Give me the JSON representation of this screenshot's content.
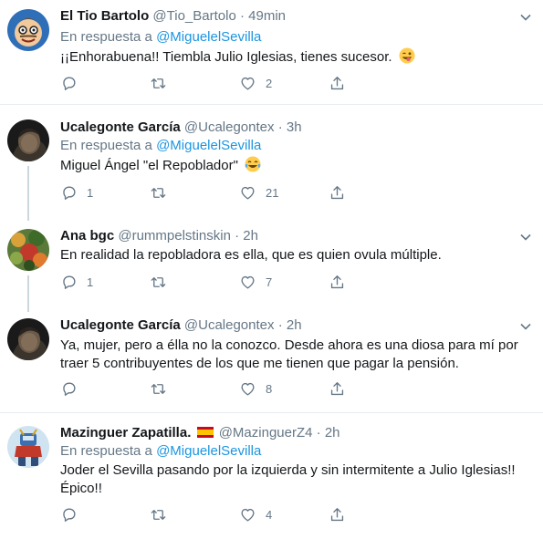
{
  "tweets": [
    {
      "name": "El Tio Bartolo",
      "handle": "@Tio_Bartolo",
      "dot": "·",
      "time": "49min",
      "reply_prefix": "En respuesta a",
      "reply_to": "@MiguelelSevilla",
      "text": "¡¡Enhorabuena!! Tiembla Julio Iglesias, tienes sucesor.",
      "emoji": "winking-tongue-emoji",
      "replies": "",
      "retweets": "",
      "likes": "2"
    },
    {
      "name": "Ucalegonte García",
      "handle": "@Ucalegontex",
      "dot": "·",
      "time": "3h",
      "reply_prefix": "En respuesta a",
      "reply_to": "@MiguelelSevilla",
      "text": "Miguel Ángel \"el Repoblador\"",
      "emoji": "tears-of-joy-emoji",
      "replies": "1",
      "retweets": "",
      "likes": "21"
    },
    {
      "name": "Ana bgc",
      "handle": "@rummpelstinskin",
      "dot": "·",
      "time": "2h",
      "text": "En realidad la repobladora es ella, que es quien ovula múltiple.",
      "replies": "1",
      "retweets": "",
      "likes": "7"
    },
    {
      "name": "Ucalegonte García",
      "handle": "@Ucalegontex",
      "dot": "·",
      "time": "2h",
      "text": "Ya, mujer, pero a élla no la conozco. Desde ahora es una diosa para mí por traer 5 contribuyentes de los que me tienen que pagar la pensión.",
      "replies": "",
      "retweets": "",
      "likes": "8"
    },
    {
      "name": "Mazinguer Zapatilla.",
      "handle": "@MazinguerZ4",
      "dot": "·",
      "time": "2h",
      "reply_prefix": "En respuesta a",
      "reply_to": "@MiguelelSevilla",
      "text": "Joder el Sevilla pasando por la izquierda y sin intermitente a Julio Iglesias!! Épico!!",
      "replies": "",
      "retweets": "",
      "likes": "4"
    }
  ],
  "colors": {
    "link": "#1b95e0",
    "secondary": "#657786",
    "text": "#14171a",
    "divider": "#e6ecf0",
    "thread": "#ccd6dd"
  }
}
